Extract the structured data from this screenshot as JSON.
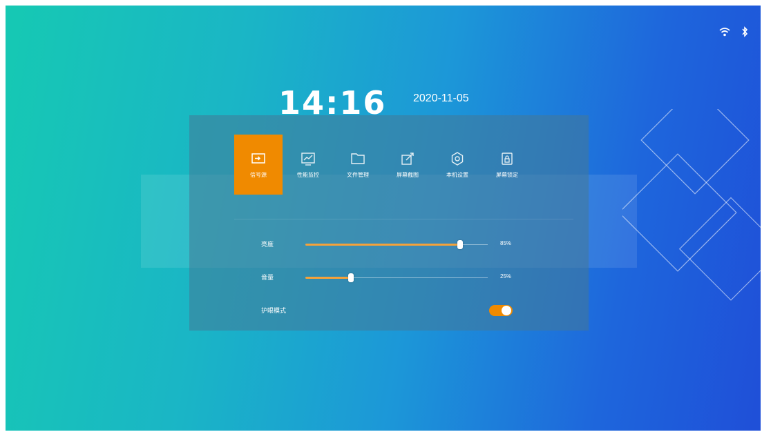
{
  "colors": {
    "accent": "#f08a00",
    "slider_fill": "#f5a23a",
    "background_start": "#16c9b3",
    "background_end": "#1f4fd8"
  },
  "status_bar": {
    "icons": [
      "wifi-icon",
      "bluetooth-icon"
    ]
  },
  "clock": {
    "time": "14:16",
    "date": "2020-11-05"
  },
  "menu": {
    "tabs": [
      {
        "label": "信号源",
        "icon": "signal-source-icon",
        "active": true
      },
      {
        "label": "性能监控",
        "icon": "performance-monitor-icon",
        "active": false
      },
      {
        "label": "文件管理",
        "icon": "folder-icon",
        "active": false
      },
      {
        "label": "屏幕截图",
        "icon": "screenshot-icon",
        "active": false
      },
      {
        "label": "本机设置",
        "icon": "settings-icon",
        "active": false
      },
      {
        "label": "屏幕锁定",
        "icon": "screen-lock-icon",
        "active": false
      }
    ]
  },
  "controls": {
    "brightness": {
      "label": "亮度",
      "value_text": "85%",
      "value": 0.85
    },
    "volume": {
      "label": "音量",
      "value_text": "25%",
      "value": 0.25
    },
    "eye_protection": {
      "label": "护眼模式",
      "enabled": true
    }
  }
}
